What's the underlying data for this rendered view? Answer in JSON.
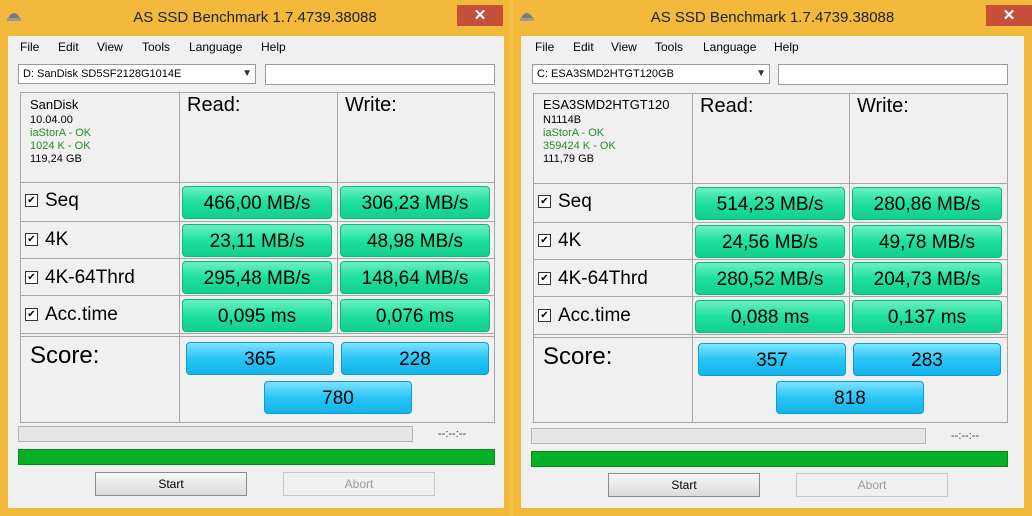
{
  "window_title": "AS SSD Benchmark 1.7.4739.38088",
  "close_glyph": "✕",
  "menu": [
    "File",
    "Edit",
    "View",
    "Tools",
    "Language",
    "Help"
  ],
  "headers": {
    "read": "Read:",
    "write": "Write:"
  },
  "rows": [
    "Seq",
    "4K",
    "4K-64Thrd",
    "Acc.time"
  ],
  "check_glyph": "✔",
  "score_label": "Score:",
  "time_text": "--:--:--",
  "buttons": {
    "start": "Start",
    "abort": "Abort"
  },
  "colors": {
    "result": "#1ee0a0",
    "score": "#28c5f6",
    "progress": "#06b025",
    "close": "#c7503b"
  },
  "left": {
    "drive": "D: SanDisk SD5SF2128G1014E",
    "info": {
      "name": "SanDisk",
      "firmware": "10.04.00",
      "driver": "iaStorA - OK",
      "align": "1024 K - OK",
      "size": "119,24 GB"
    },
    "read": [
      "466,00 MB/s",
      "23,11 MB/s",
      "295,48 MB/s",
      "0,095 ms"
    ],
    "write": [
      "306,23 MB/s",
      "48,98 MB/s",
      "148,64 MB/s",
      "0,076 ms"
    ],
    "score": {
      "read": "365",
      "write": "228",
      "total": "780"
    }
  },
  "right": {
    "drive": "C: ESA3SMD2HTGT120GB",
    "info": {
      "name": "ESA3SMD2HTGT120",
      "firmware": "N1114B",
      "driver": "iaStorA - OK",
      "align": "359424 K - OK",
      "size": "111,79 GB"
    },
    "read": [
      "514,23 MB/s",
      "24,56 MB/s",
      "280,52 MB/s",
      "0,088 ms"
    ],
    "write": [
      "280,86 MB/s",
      "49,78 MB/s",
      "204,73 MB/s",
      "0,137 ms"
    ],
    "score": {
      "read": "357",
      "write": "283",
      "total": "818"
    }
  }
}
